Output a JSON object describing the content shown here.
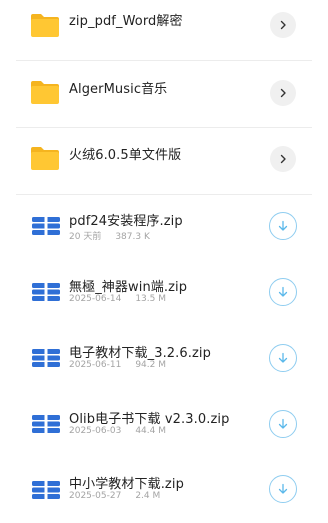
{
  "colors": {
    "folder": "#FFC733",
    "zip": "#2F6FD6",
    "download_ring": "#8FCDF0"
  },
  "folders": [
    {
      "name": "zip_pdf_Word解密",
      "action_icon": "chevron-right-icon"
    },
    {
      "name": "AlgerMusic音乐",
      "action_icon": "chevron-right-icon"
    },
    {
      "name": "火绒6.0.5单文件版",
      "action_icon": "chevron-right-icon"
    }
  ],
  "files": [
    {
      "name": "pdf24安装程序.zip",
      "date": "20 天前",
      "size": "387.3 K",
      "action_icon": "download-icon"
    },
    {
      "name": "無極_神器win端.zip",
      "date": "2025-06-14",
      "size": "13.5 M",
      "action_icon": "download-icon"
    },
    {
      "name": "电子教材下载_3.2.6.zip",
      "date": "2025-06-11",
      "size": "94.2 M",
      "action_icon": "download-icon"
    },
    {
      "name": "Olib电子书下载 v2.3.0.zip",
      "date": "2025-06-03",
      "size": "44.4 M",
      "action_icon": "download-icon"
    },
    {
      "name": "中小学教材下载.zip",
      "date": "2025-05-27",
      "size": "2.4 M",
      "action_icon": "download-icon"
    }
  ]
}
